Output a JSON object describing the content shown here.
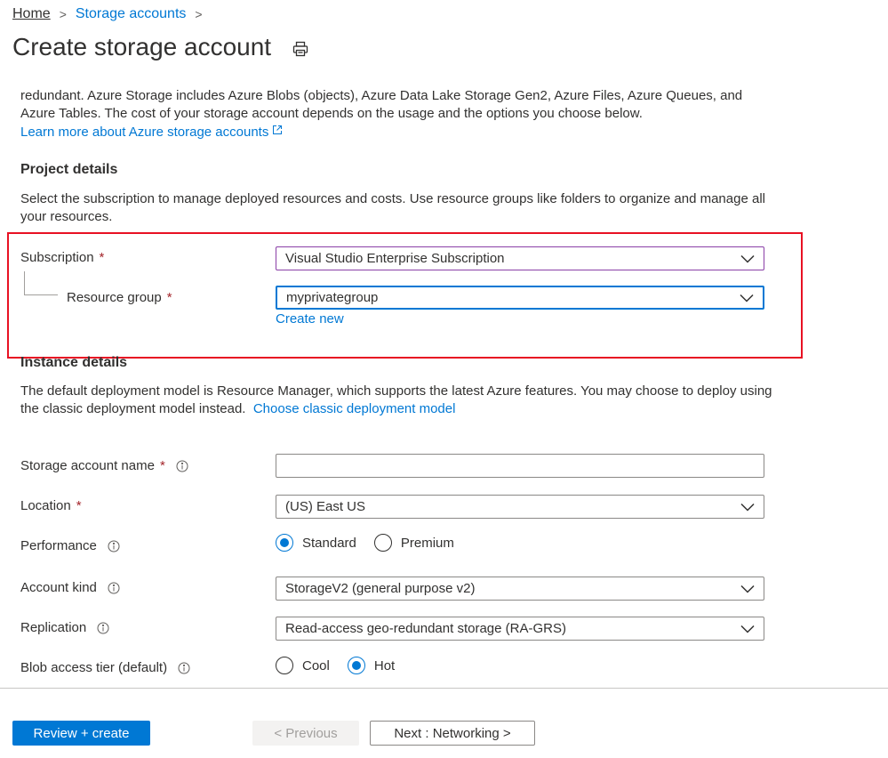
{
  "breadcrumb": {
    "home": "Home",
    "storage_accounts": "Storage accounts",
    "sep": ">"
  },
  "page": {
    "title": "Create storage account"
  },
  "intro": {
    "text": "redundant. Azure Storage includes Azure Blobs (objects), Azure Data Lake Storage Gen2, Azure Files, Azure Queues, and Azure Tables. The cost of your storage account depends on the usage and the options you choose below.",
    "learn_more": "Learn more about Azure storage accounts"
  },
  "project_details": {
    "heading": "Project details",
    "description": "Select the subscription to manage deployed resources and costs. Use resource groups like folders to organize and manage all your resources.",
    "subscription_label": "Subscription",
    "subscription_value": "Visual Studio Enterprise Subscription",
    "resource_group_label": "Resource group",
    "resource_group_value": "myprivategroup",
    "create_new": "Create new"
  },
  "instance_details": {
    "heading": "Instance details",
    "description": "The default deployment model is Resource Manager, which supports the latest Azure features. You may choose to deploy using the classic deployment model instead.",
    "classic_link": "Choose classic deployment model",
    "storage_name_label": "Storage account name",
    "storage_name_value": "",
    "location_label": "Location",
    "location_value": "(US) East US",
    "performance_label": "Performance",
    "performance_options": [
      "Standard",
      "Premium"
    ],
    "performance_selected": "Standard",
    "account_kind_label": "Account kind",
    "account_kind_value": "StorageV2 (general purpose v2)",
    "replication_label": "Replication",
    "replication_value": "Read-access geo-redundant storage (RA-GRS)",
    "access_tier_label": "Blob access tier (default)",
    "access_tier_options": [
      "Cool",
      "Hot"
    ],
    "access_tier_selected": "Hot"
  },
  "required_mark": "*",
  "footer": {
    "review_create": "Review + create",
    "previous": "< Previous",
    "next": "Next : Networking >"
  },
  "colors": {
    "accent": "#0078d4",
    "highlight_border": "#e81123",
    "required": "#a4262c"
  }
}
